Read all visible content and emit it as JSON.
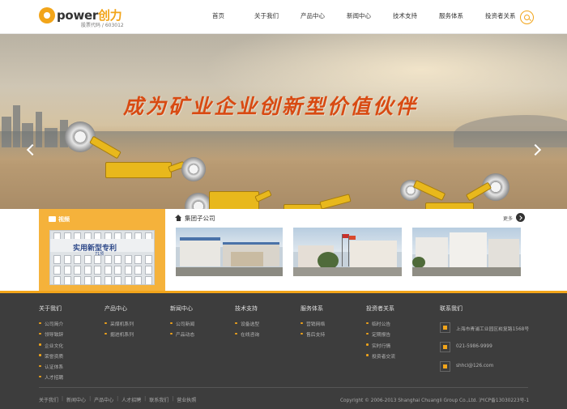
{
  "header": {
    "logo_text": "power",
    "logo_cn": "创力",
    "stock_code": "股票代码 / 603012",
    "nav": [
      "首页",
      "关于我们",
      "产品中心",
      "新闻中心",
      "技术支持",
      "服务体系",
      "投资者关系"
    ],
    "search_icon": "search-icon"
  },
  "banner": {
    "slogan": "成为矿业企业创新型价值伙伴",
    "slide_count": 5,
    "active_slide": 1
  },
  "video": {
    "title": "视频",
    "thumb_title": "实用新型专利",
    "thumb_sub": "71项"
  },
  "group": {
    "title": "集团子公司",
    "more": "更多"
  },
  "footer": {
    "columns": [
      {
        "title": "关于我们",
        "links": [
          "公司简介",
          "领导致辞",
          "企业文化",
          "荣誉资质",
          "认证体系",
          "人才招聘"
        ]
      },
      {
        "title": "产品中心",
        "links": [
          "采煤机系列",
          "掘进机系列"
        ]
      },
      {
        "title": "新闻中心",
        "links": [
          "公司新闻",
          "产品动态"
        ]
      },
      {
        "title": "技术支持",
        "links": [
          "设备选型",
          "在线咨询"
        ]
      },
      {
        "title": "服务体系",
        "links": [
          "营销网络",
          "售后支持"
        ]
      },
      {
        "title": "投资者关系",
        "links": [
          "临时公告",
          "定期报告",
          "实时行情",
          "投资者交流"
        ]
      }
    ],
    "contact": {
      "title": "联系我们",
      "address": "上海市青浦工业园区崧复路1568号",
      "phone": "021-5986-9999",
      "email": "shhcl@126.com"
    },
    "bottom_links": [
      "关于我们",
      "新闻中心",
      "产品中心",
      "人才招聘",
      "联系我们",
      "营业执照"
    ],
    "copyright": "Copyright © 2006-2013 Shanghai Chuangli Group Co.,Ltd. 沪ICP备13030223号-1"
  },
  "colors": {
    "accent": "#f2a51a",
    "footer_bg": "#3d3d3d",
    "slogan": "#d84a12"
  }
}
